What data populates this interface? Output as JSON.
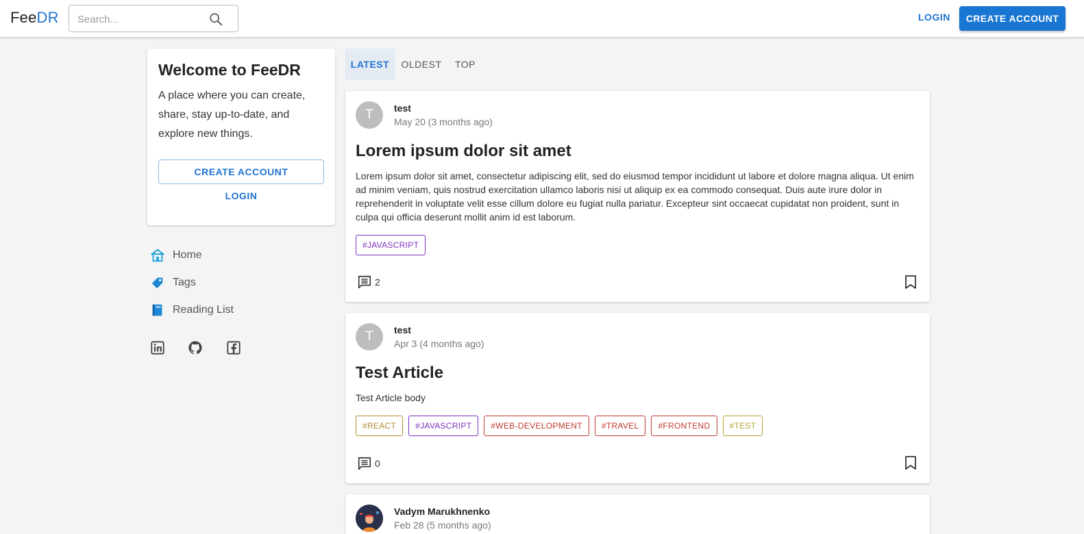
{
  "header": {
    "logo_part1": "Fee",
    "logo_part2": "DR",
    "search_placeholder": "Search...",
    "login_label": "LOGIN",
    "create_account_label": "CREATE ACCOUNT",
    "accent_color": "#1976d2"
  },
  "welcome": {
    "title": "Welcome to FeeDR",
    "description": "A place where you can create, share, stay up-to-date, and explore new things.",
    "create_account_label": "CREATE ACCOUNT",
    "login_label": "LOGIN"
  },
  "sidebar": {
    "items": [
      {
        "label": "Home",
        "icon": "home-icon"
      },
      {
        "label": "Tags",
        "icon": "tag-icon"
      },
      {
        "label": "Reading List",
        "icon": "book-icon"
      }
    ],
    "social": [
      "linkedin-icon",
      "github-icon",
      "facebook-icon"
    ]
  },
  "tabs": [
    {
      "label": "LATEST",
      "active": true
    },
    {
      "label": "OLDEST",
      "active": false
    },
    {
      "label": "TOP",
      "active": false
    }
  ],
  "posts": [
    {
      "avatar_letter": "T",
      "author": "test",
      "date": "May 20 (3 months ago)",
      "title": "Lorem ipsum dolor sit amet",
      "body": "Lorem ipsum dolor sit amet, consectetur adipiscing elit, sed do eiusmod tempor incididunt ut labore et dolore magna aliqua. Ut enim ad minim veniam, quis nostrud exercitation ullamco laboris nisi ut aliquip ex ea commodo consequat. Duis aute irure dolor in reprehenderit in voluptate velit esse cillum dolore eu fugiat nulla pariatur. Excepteur sint occaecat cupidatat non proident, sunt in culpa qui officia deserunt mollit anim id est laborum.",
      "tags": [
        {
          "label": "#JAVASCRIPT",
          "color": "#7b2fbf"
        }
      ],
      "comment_count": "2"
    },
    {
      "avatar_letter": "T",
      "author": "test",
      "date": "Apr 3 (4 months ago)",
      "title": "Test Article",
      "body": "Test Article body",
      "tags": [
        {
          "label": "#REACT",
          "color": "#b38a2e"
        },
        {
          "label": "#JAVASCRIPT",
          "color": "#7b2fbf"
        },
        {
          "label": "#WEB-DEVELOPMENT",
          "color": "#c0392b"
        },
        {
          "label": "#TRAVEL",
          "color": "#c0392b"
        },
        {
          "label": "#FRONTEND",
          "color": "#c0392b"
        },
        {
          "label": "#TEST",
          "color": "#b5a42e"
        }
      ],
      "comment_count": "0"
    },
    {
      "author": "Vadym Marukhnenko",
      "date": "Feb 28 (5 months ago)"
    }
  ]
}
